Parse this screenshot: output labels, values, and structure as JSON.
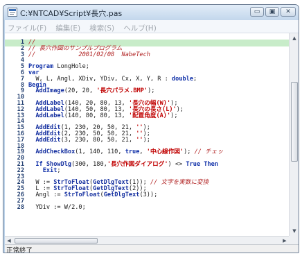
{
  "window": {
    "title": "C:¥NTCAD¥Script¥長穴.pas",
    "controls": {
      "minimize": "▭",
      "maximize": "▣",
      "close": "✕"
    }
  },
  "menu": [
    "ファイル(F)",
    "編集(E)",
    "検索(S)",
    "ヘルプ(H)"
  ],
  "editor": {
    "lines": [
      {
        "n": "1",
        "tokens": [
          {
            "t": "//",
            "c": "cmt"
          }
        ]
      },
      {
        "n": "2",
        "tokens": [
          {
            "t": "// 長穴作図のサンプルプログラム",
            "c": "cmt"
          }
        ]
      },
      {
        "n": "3",
        "tokens": [
          {
            "t": "//            2001/02/08  NabeTech",
            "c": "cmt"
          }
        ]
      },
      {
        "n": "4",
        "tokens": []
      },
      {
        "n": "5",
        "tokens": [
          {
            "t": "Program",
            "c": "kw"
          },
          {
            "t": " LongHole;",
            "c": "txt"
          }
        ]
      },
      {
        "n": "6",
        "tokens": [
          {
            "t": "var",
            "c": "kw"
          }
        ]
      },
      {
        "n": "7",
        "tokens": [
          {
            "t": "  W, L, Angl, XDiv, YDiv, Cx, X, Y, R : ",
            "c": "txt"
          },
          {
            "t": "double",
            "c": "kw"
          },
          {
            "t": ";",
            "c": "txt"
          }
        ]
      },
      {
        "n": "8",
        "tokens": [
          {
            "t": "Begin",
            "c": "kw"
          }
        ]
      },
      {
        "n": "9",
        "tokens": [
          {
            "t": "  AddImage",
            "c": "fn"
          },
          {
            "t": "(20, 20, ",
            "c": "txt"
          },
          {
            "t": "'長穴パラメ.BMP'",
            "c": "str"
          },
          {
            "t": ");",
            "c": "txt"
          }
        ]
      },
      {
        "n": "10",
        "tokens": []
      },
      {
        "n": "11",
        "tokens": [
          {
            "t": "  AddLabel",
            "c": "fn"
          },
          {
            "t": "(140, 20, 80, 13, ",
            "c": "txt"
          },
          {
            "t": "'長穴の幅(W)'",
            "c": "str"
          },
          {
            "t": ");",
            "c": "txt"
          }
        ]
      },
      {
        "n": "12",
        "tokens": [
          {
            "t": "  AddLabel",
            "c": "fn"
          },
          {
            "t": "(140, 50, 80, 13, ",
            "c": "txt"
          },
          {
            "t": "'長穴の長さ(L)'",
            "c": "str"
          },
          {
            "t": ");",
            "c": "txt"
          }
        ]
      },
      {
        "n": "13",
        "tokens": [
          {
            "t": "  AddLabel",
            "c": "fn"
          },
          {
            "t": "(140, 80, 80, 13, ",
            "c": "txt"
          },
          {
            "t": "'配置角度(A)'",
            "c": "str"
          },
          {
            "t": ");",
            "c": "txt"
          }
        ]
      },
      {
        "n": "14",
        "tokens": []
      },
      {
        "n": "15",
        "tokens": [
          {
            "t": "  AddEdit",
            "c": "fn"
          },
          {
            "t": "(1, 230, 20, 50, 21, ",
            "c": "txt"
          },
          {
            "t": "''",
            "c": "str"
          },
          {
            "t": ");",
            "c": "txt"
          }
        ]
      },
      {
        "n": "16",
        "tokens": [
          {
            "t": "  AddEdit",
            "c": "fn"
          },
          {
            "t": "(2, 230, 50, 50, 21, ",
            "c": "txt"
          },
          {
            "t": "''",
            "c": "str"
          },
          {
            "t": ");",
            "c": "txt"
          }
        ]
      },
      {
        "n": "17",
        "tokens": [
          {
            "t": "  AddEdit",
            "c": "fn"
          },
          {
            "t": "(3, 230, 80, 50, 21, ",
            "c": "txt"
          },
          {
            "t": "''",
            "c": "str"
          },
          {
            "t": ");",
            "c": "txt"
          }
        ]
      },
      {
        "n": "18",
        "tokens": []
      },
      {
        "n": "19",
        "tokens": [
          {
            "t": "  AddCheckBox",
            "c": "fn"
          },
          {
            "t": "(1, 140, 110, ",
            "c": "txt"
          },
          {
            "t": "true",
            "c": "kw"
          },
          {
            "t": ", ",
            "c": "txt"
          },
          {
            "t": "'中心線作図'",
            "c": "str"
          },
          {
            "t": "); ",
            "c": "txt"
          },
          {
            "t": "// チェッ",
            "c": "cmt"
          }
        ]
      },
      {
        "n": "20",
        "tokens": []
      },
      {
        "n": "21",
        "tokens": [
          {
            "t": "  If ",
            "c": "kw"
          },
          {
            "t": "ShowDlg",
            "c": "fn"
          },
          {
            "t": "(300, 180,",
            "c": "txt"
          },
          {
            "t": "'長穴作図ダイアログ'",
            "c": "str"
          },
          {
            "t": ") <> ",
            "c": "txt"
          },
          {
            "t": "True Then",
            "c": "kw"
          }
        ]
      },
      {
        "n": "22",
        "tokens": [
          {
            "t": "    Exit",
            "c": "kw"
          },
          {
            "t": ";",
            "c": "txt"
          }
        ]
      },
      {
        "n": "23",
        "tokens": []
      },
      {
        "n": "24",
        "tokens": [
          {
            "t": "  W := ",
            "c": "txt"
          },
          {
            "t": "StrToFloat",
            "c": "fn"
          },
          {
            "t": "(",
            "c": "txt"
          },
          {
            "t": "GetDlgText",
            "c": "fn"
          },
          {
            "t": "(1)); ",
            "c": "txt"
          },
          {
            "t": "// 文字を実数に変換",
            "c": "cmt"
          }
        ]
      },
      {
        "n": "25",
        "tokens": [
          {
            "t": "  L := ",
            "c": "txt"
          },
          {
            "t": "StrToFloat",
            "c": "fn"
          },
          {
            "t": "(",
            "c": "txt"
          },
          {
            "t": "GetDlgText",
            "c": "fn"
          },
          {
            "t": "(2));",
            "c": "txt"
          }
        ]
      },
      {
        "n": "26",
        "tokens": [
          {
            "t": "  Angl := ",
            "c": "txt"
          },
          {
            "t": "StrToFloat",
            "c": "fn"
          },
          {
            "t": "(",
            "c": "txt"
          },
          {
            "t": "GetDlgText",
            "c": "fn"
          },
          {
            "t": "(3));",
            "c": "txt"
          }
        ]
      },
      {
        "n": "27",
        "tokens": []
      },
      {
        "n": "28",
        "tokens": [
          {
            "t": "  YDiv := W/2.0;",
            "c": "txt"
          }
        ]
      }
    ]
  },
  "scrollbar": {
    "up": "▲",
    "down": "▼",
    "left": "◀",
    "right": "▶"
  },
  "status": {
    "text": "正常終了"
  }
}
